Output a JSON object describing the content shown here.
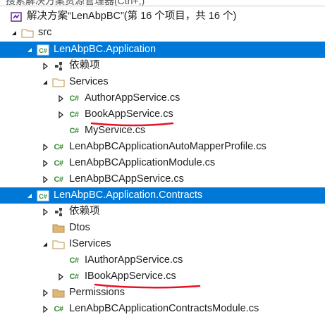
{
  "search": {
    "placeholder": "搜索解决方案资源管理器(Ctrl+;)"
  },
  "tree": {
    "solution": "解决方案“LenAbpBC”(第 16 个项目，共 16 个)",
    "src": "src",
    "app_project": "LenAbpBC.Application",
    "app_dependencies": "依赖项",
    "services_folder": "Services",
    "author_service": "AuthorAppService.cs",
    "book_service": "BookAppService.cs",
    "my_service": "MyService.cs",
    "automapper_profile": "LenAbpBCApplicationAutoMapperProfile.cs",
    "app_module": "LenAbpBCApplicationModule.cs",
    "app_service": "LenAbpBCAppService.cs",
    "contracts_project": "LenAbpBC.Application.Contracts",
    "contracts_dependencies": "依赖项",
    "dtos_folder": "Dtos",
    "iservices_folder": "IServices",
    "iauthor_service": "IAuthorAppService.cs",
    "ibook_service": "IBookAppService.cs",
    "permissions_folder": "Permissions",
    "contracts_module": "LenAbpBCApplicationContractsModule.cs"
  },
  "icons": {
    "solution": "solution-icon",
    "folder": "folder-icon",
    "csharp_project": "csharp-project-icon",
    "dependencies": "dependencies-icon",
    "csharp_file": "csharp-file-icon"
  },
  "colors": {
    "selection": "#0078d7",
    "folder": "#dcb67a",
    "csharp": "#388a34",
    "annotation": "#e81123"
  }
}
